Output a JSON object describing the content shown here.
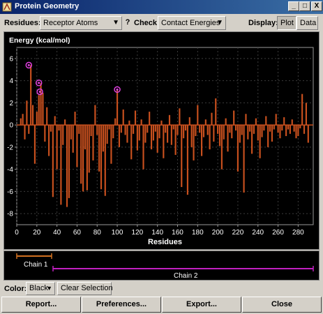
{
  "window": {
    "title": "Protein Geometry",
    "minimize": "_",
    "maximize": "□",
    "close": "X"
  },
  "toolbar": {
    "residues_label": "Residues:",
    "residues_value": "Receptor Atoms",
    "help": "?",
    "check_label": "Check:",
    "check_value": "Contact Energies",
    "display_label": "Display:",
    "display_plot": "Plot",
    "display_data": "Data"
  },
  "colors": {
    "bars": "#c8501e",
    "highlight": "#e040e0",
    "chain1": "#d07020",
    "chain2": "#c020c0",
    "grid": "#3c3c3c"
  },
  "chart_data": {
    "type": "bar",
    "title": "Energy (kcal/mol)",
    "xlabel": "Residues",
    "ylabel": "Energy (kcal/mol)",
    "xlim": [
      0,
      295
    ],
    "ylim": [
      -9,
      7
    ],
    "xticks": [
      0,
      20,
      40,
      60,
      80,
      100,
      120,
      140,
      160,
      180,
      200,
      220,
      240,
      260,
      280
    ],
    "yticks": [
      -8,
      -6,
      -4,
      -2,
      0,
      2,
      4,
      6
    ],
    "grid": true,
    "x": [
      4,
      6,
      8,
      10,
      12,
      14,
      16,
      18,
      20,
      22,
      24,
      26,
      28,
      30,
      32,
      34,
      36,
      38,
      40,
      42,
      44,
      46,
      48,
      50,
      52,
      54,
      56,
      58,
      60,
      62,
      64,
      66,
      68,
      70,
      72,
      74,
      76,
      78,
      80,
      82,
      84,
      86,
      88,
      90,
      92,
      94,
      96,
      98,
      100,
      102,
      104,
      106,
      108,
      110,
      112,
      114,
      116,
      118,
      120,
      122,
      124,
      126,
      128,
      130,
      132,
      134,
      136,
      138,
      140,
      142,
      144,
      146,
      148,
      150,
      152,
      154,
      156,
      158,
      160,
      162,
      164,
      166,
      168,
      170,
      172,
      174,
      176,
      178,
      180,
      182,
      184,
      186,
      188,
      190,
      192,
      194,
      196,
      198,
      200,
      202,
      204,
      206,
      208,
      210,
      212,
      214,
      216,
      218,
      220,
      222,
      224,
      226,
      228,
      230,
      232,
      234,
      236,
      238,
      240,
      242,
      244,
      246,
      248,
      250,
      252,
      254,
      256,
      258,
      260,
      262,
      264,
      266,
      268,
      270,
      272,
      274,
      276,
      278,
      280,
      282,
      284,
      286,
      288,
      290
    ],
    "values": [
      0.6,
      1.0,
      -1.3,
      2.2,
      -0.8,
      5.4,
      1.8,
      -3.5,
      1.2,
      2.7,
      3.8,
      2.9,
      -1.5,
      1.6,
      -2.8,
      -0.6,
      -6.5,
      0.8,
      -4.0,
      -0.5,
      -7.2,
      -1.8,
      0.5,
      -7.4,
      -6.6,
      -1.3,
      -2.5,
      1.2,
      -3.8,
      -0.8,
      -5.3,
      -6.0,
      -2.2,
      -5.9,
      -4.3,
      -1.0,
      -3.2,
      1.8,
      -0.9,
      -4.2,
      -5.8,
      -2.4,
      -6.4,
      -1.7,
      -0.4,
      -3.5,
      -1.2,
      0.6,
      3.2,
      -2.0,
      -0.7,
      1.4,
      -0.9,
      -1.6,
      0.4,
      -3.1,
      -0.8,
      1.3,
      -2.3,
      -1.4,
      0.5,
      -4.0,
      -1.6,
      -0.7,
      1.2,
      -2.2,
      -1.4,
      -0.6,
      -2.5,
      -1.2,
      0.4,
      -3.0,
      -0.7,
      -1.6,
      0.9,
      -1.8,
      -0.4,
      -2.7,
      -0.9,
      1.5,
      -5.6,
      -1.2,
      -0.5,
      -6.3,
      0.7,
      -2.0,
      -3.2,
      -1.0,
      1.8,
      -0.7,
      -2.8,
      -1.1,
      0.5,
      -0.9,
      -2.2,
      1.1,
      -1.5,
      2.4,
      -0.8,
      -1.9,
      -4.0,
      -1.3,
      0.6,
      -2.4,
      -0.7,
      -1.2,
      1.3,
      -0.5,
      -4.2,
      -1.6,
      -0.9,
      -6.1,
      1.0,
      -1.3,
      -0.6,
      -2.6,
      -0.8,
      0.6,
      -1.4,
      -3.0,
      -1.1,
      -0.5,
      0.8,
      -2.0,
      -0.6,
      -1.5,
      -0.4,
      1.0,
      -0.7,
      -1.2,
      -0.5,
      0.7,
      -1.0,
      -0.4,
      -0.8,
      0.5,
      -0.6,
      -1.2,
      -1.0,
      -0.3,
      2.8,
      -0.8,
      2.0,
      -1.6
    ],
    "highlighted": [
      {
        "x": 12,
        "y": 5.4
      },
      {
        "x": 22,
        "y": 3.8
      },
      {
        "x": 23,
        "y": 3.0
      },
      {
        "x": 100,
        "y": 3.2
      }
    ]
  },
  "chains": {
    "chain1_label": "Chain 1",
    "chain2_label": "Chain 2"
  },
  "bottom": {
    "color_label": "Color:",
    "color_value": "Black",
    "clear_selection": "Clear Selection"
  },
  "actions": {
    "report": "Report...",
    "preferences": "Preferences...",
    "export": "Export...",
    "close": "Close"
  }
}
